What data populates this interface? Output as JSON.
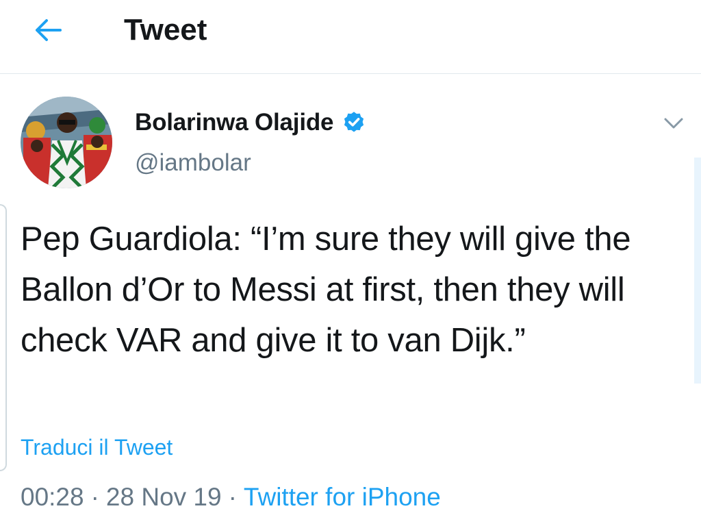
{
  "header": {
    "back_icon": "arrow-left-icon",
    "title": "Tweet"
  },
  "author": {
    "name": "Bolarinwa Olajide",
    "handle": "@iambolar",
    "verified": true,
    "verified_icon": "verified-badge-icon"
  },
  "caret_icon": "chevron-down-icon",
  "tweet": {
    "text": "Pep Guardiola: “I’m sure they will give the Ballon d’Or to Messi at first, then they will check VAR and give it to van Dijk.”",
    "translate_label": "Traduci il Tweet"
  },
  "meta": {
    "time": "00:28",
    "date": "28 Nov 19",
    "separator": "·",
    "source": "Twitter for iPhone"
  },
  "colors": {
    "accent": "#1da1f2",
    "text": "#14171a",
    "secondary": "#657786",
    "divider": "#e1e8ed"
  }
}
